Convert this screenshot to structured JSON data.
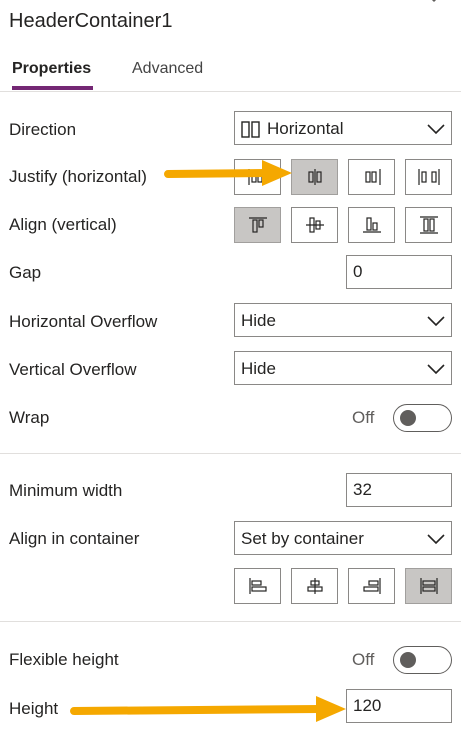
{
  "panel": {
    "title": "HeaderContainer1"
  },
  "tabs": [
    {
      "label": "Properties",
      "active": true
    },
    {
      "label": "Advanced",
      "active": false
    }
  ],
  "layout": {
    "direction": {
      "label": "Direction",
      "value": "Horizontal",
      "icon": "horizontal-layout-icon"
    },
    "justify": {
      "label": "Justify (horizontal)",
      "options": [
        "justify-start-icon",
        "justify-center-icon",
        "justify-end-icon",
        "justify-space-between-icon"
      ],
      "selected_index": 1
    },
    "align": {
      "label": "Align (vertical)",
      "options": [
        "align-top-icon",
        "align-middle-icon",
        "align-bottom-icon",
        "align-stretch-icon"
      ],
      "selected_index": 0
    },
    "gap": {
      "label": "Gap",
      "value": "0"
    },
    "horizontal_overflow": {
      "label": "Horizontal Overflow",
      "value": "Hide"
    },
    "vertical_overflow": {
      "label": "Vertical Overflow",
      "value": "Hide"
    },
    "wrap": {
      "label": "Wrap",
      "state": "Off"
    }
  },
  "sizing": {
    "min_width": {
      "label": "Minimum width",
      "value": "32"
    },
    "align_in_container": {
      "label": "Align in container",
      "value": "Set by container",
      "options": [
        "align-left-icon",
        "align-center-icon",
        "align-right-icon",
        "align-stretch-horizontal-icon"
      ],
      "selected_index": 3
    },
    "flexible_height": {
      "label": "Flexible height",
      "state": "Off"
    },
    "height": {
      "label": "Height",
      "value": "120"
    }
  },
  "colors": {
    "accent": "#742774",
    "arrow": "#F5A800",
    "selected_bg": "#C8C6C4"
  }
}
